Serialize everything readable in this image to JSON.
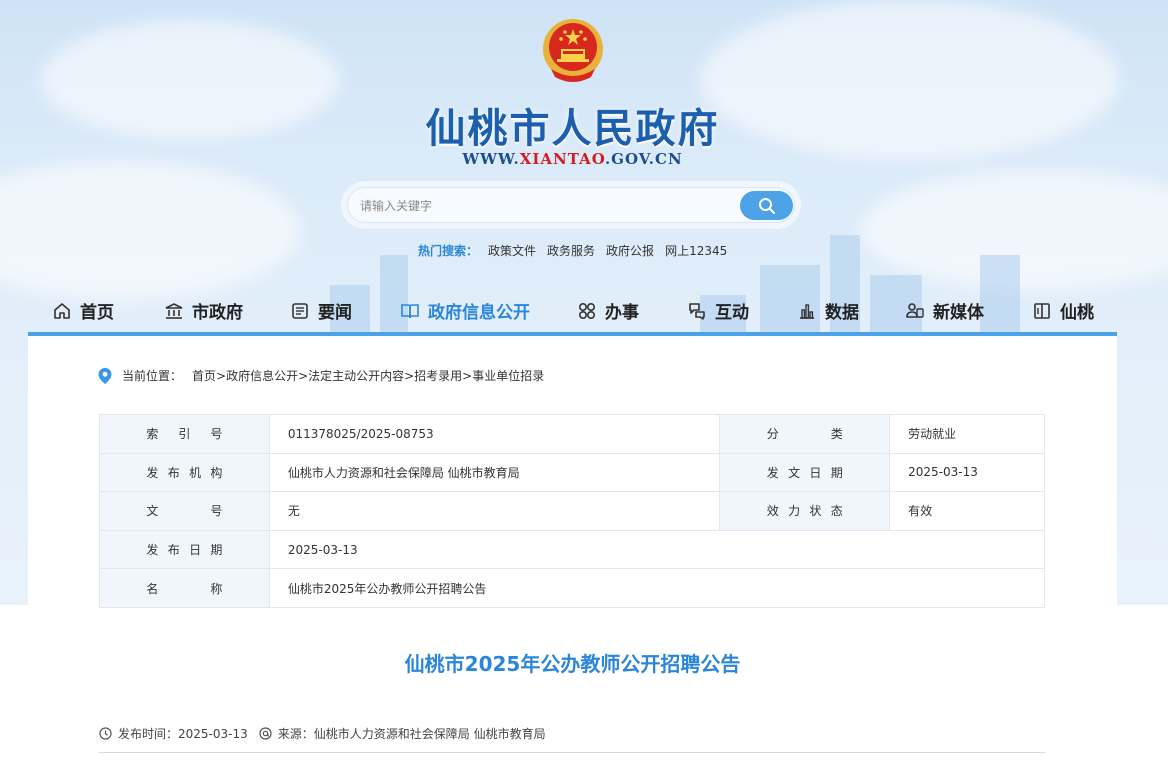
{
  "header": {
    "site_title": "仙桃市人民政府",
    "url_prefix": "WWW.",
    "url_highlight": "XIANTAO",
    "url_suffix": ".GOV.CN",
    "emblem_icon": "national-emblem-icon"
  },
  "search": {
    "placeholder": "请输入关键字",
    "button_icon": "search-icon"
  },
  "hot_search": {
    "label": "热门搜索：",
    "items": [
      "政策文件",
      "政务服务",
      "政府公报",
      "网上12345"
    ]
  },
  "nav": {
    "items": [
      {
        "label": "首页",
        "icon": "home-icon"
      },
      {
        "label": "市政府",
        "icon": "government-building-icon"
      },
      {
        "label": "要闻",
        "icon": "news-icon"
      },
      {
        "label": "政府信息公开",
        "icon": "book-icon",
        "active": true
      },
      {
        "label": "办事",
        "icon": "grid-icon"
      },
      {
        "label": "互动",
        "icon": "interaction-icon"
      },
      {
        "label": "数据",
        "icon": "bar-chart-icon"
      },
      {
        "label": "新媒体",
        "icon": "media-icon"
      },
      {
        "label": "仙桃",
        "icon": "xiantao-book-icon"
      }
    ],
    "active_color": "#2b86d8",
    "bar_color": "#4aa3ea"
  },
  "breadcrumb": {
    "label": "当前位置：",
    "path": "首页>政府信息公开>法定主动公开内容>招考录用>事业单位招录"
  },
  "meta": {
    "index_no_label": "索 引 号",
    "index_no": "011378025/2025-08753",
    "category_label": "分 类",
    "category": "劳动就业",
    "publisher_label": "发 布 机 构",
    "publisher": "仙桃市人力资源和社会保障局 仙桃市教育局",
    "issue_date_label": "发 文 日 期",
    "issue_date": "2025-03-13",
    "doc_no_label": "文 号",
    "doc_no": "无",
    "validity_label": "效 力 状 态",
    "validity": "有效",
    "publish_date_label": "发 布 日 期",
    "publish_date": "2025-03-13",
    "name_label": "名 称",
    "name": "仙桃市2025年公办教师公开招聘公告"
  },
  "article": {
    "title": "仙桃市2025年公办教师公开招聘公告",
    "time_label": "发布时间：",
    "time": "2025-03-13",
    "source_label": "来源：",
    "source": "仙桃市人力资源和社会保障局 仙桃市教育局"
  }
}
